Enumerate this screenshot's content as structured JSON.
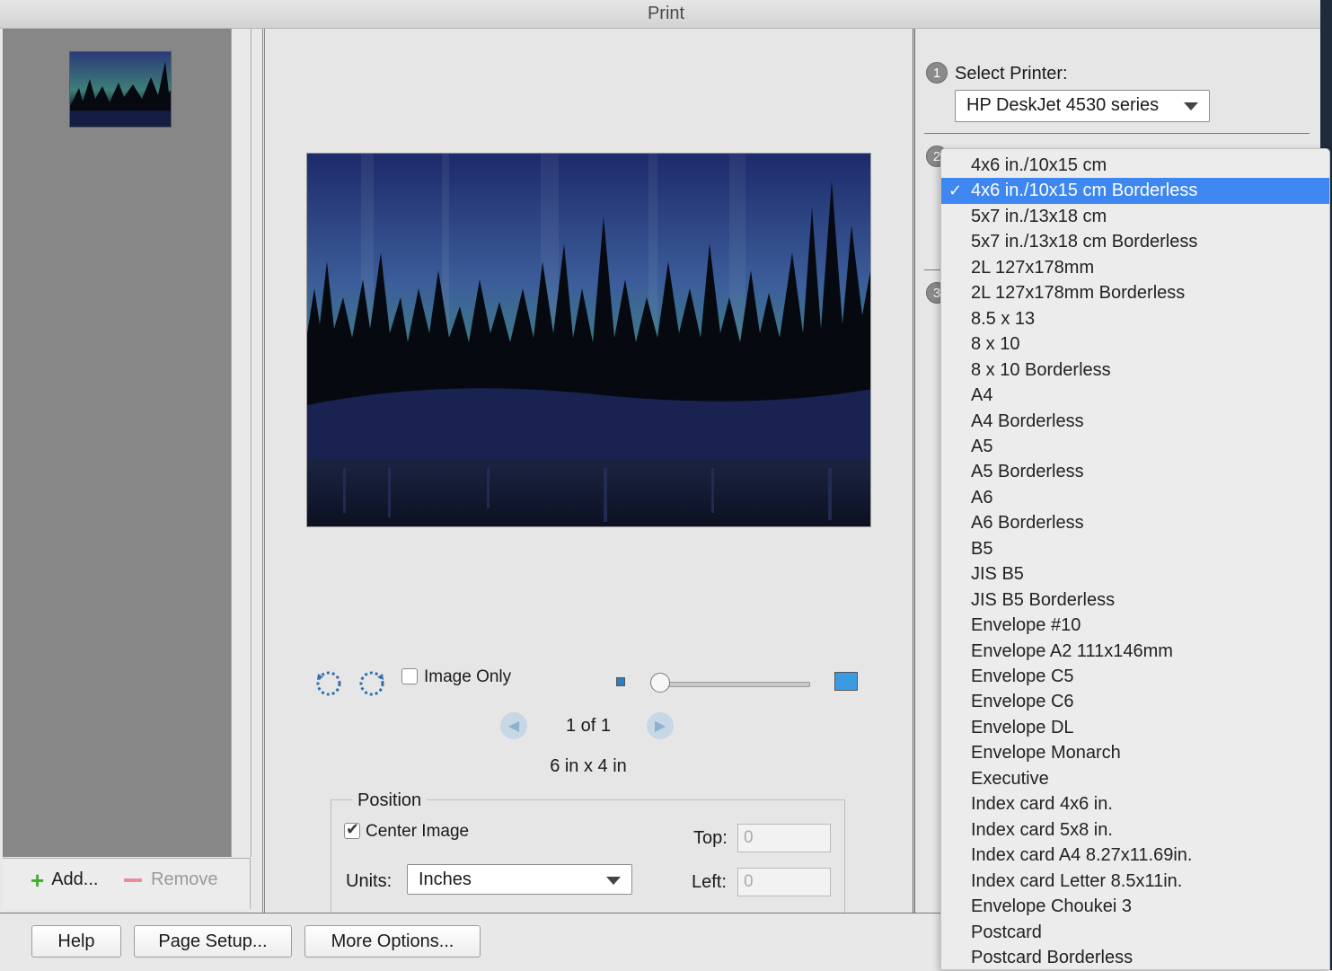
{
  "window": {
    "title": "Print"
  },
  "thumbnails": {
    "add_label": "Add...",
    "remove_label": "Remove"
  },
  "preview": {
    "image_only_label": "Image Only",
    "page_indicator": "1 of 1",
    "size_label": "6 in x 4 in"
  },
  "position": {
    "title": "Position",
    "center_image_label": "Center Image",
    "center_image_checked": true,
    "units_label": "Units:",
    "units_value": "Inches",
    "top_label": "Top:",
    "top_value": "0",
    "left_label": "Left:",
    "left_value": "0"
  },
  "printer": {
    "step1": "1",
    "step2": "2",
    "step3": "3",
    "select_label": "Select Printer:",
    "printer_value": "HP DeskJet 4530 series"
  },
  "paper_menu": {
    "selected_index": 1,
    "items": [
      "4x6 in./10x15 cm",
      "4x6 in./10x15 cm Borderless",
      "5x7 in./13x18 cm",
      "5x7 in./13x18 cm Borderless",
      "2L 127x178mm",
      "2L 127x178mm Borderless",
      "8.5 x 13",
      "8 x 10",
      "8 x 10 Borderless",
      "A4",
      "A4 Borderless",
      "A5",
      "A5 Borderless",
      "A6",
      "A6 Borderless",
      "B5",
      "JIS B5",
      "JIS B5 Borderless",
      "Envelope #10",
      "Envelope A2 111x146mm",
      "Envelope C5",
      "Envelope C6",
      "Envelope DL",
      "Envelope Monarch",
      "Executive",
      "Index card 4x6 in.",
      "Index card 5x8 in.",
      "Index card A4 8.27x11.69in.",
      "Index card Letter 8.5x11in.",
      "Envelope Choukei 3",
      "Postcard",
      "Postcard Borderless"
    ]
  },
  "footer": {
    "help_label": "Help",
    "page_setup_label": "Page Setup...",
    "more_options_label": "More Options..."
  },
  "colors": {
    "menu_highlight": "#3e86f0",
    "add_icon": "#3fae2a",
    "remove_icon": "#e98b9a"
  }
}
